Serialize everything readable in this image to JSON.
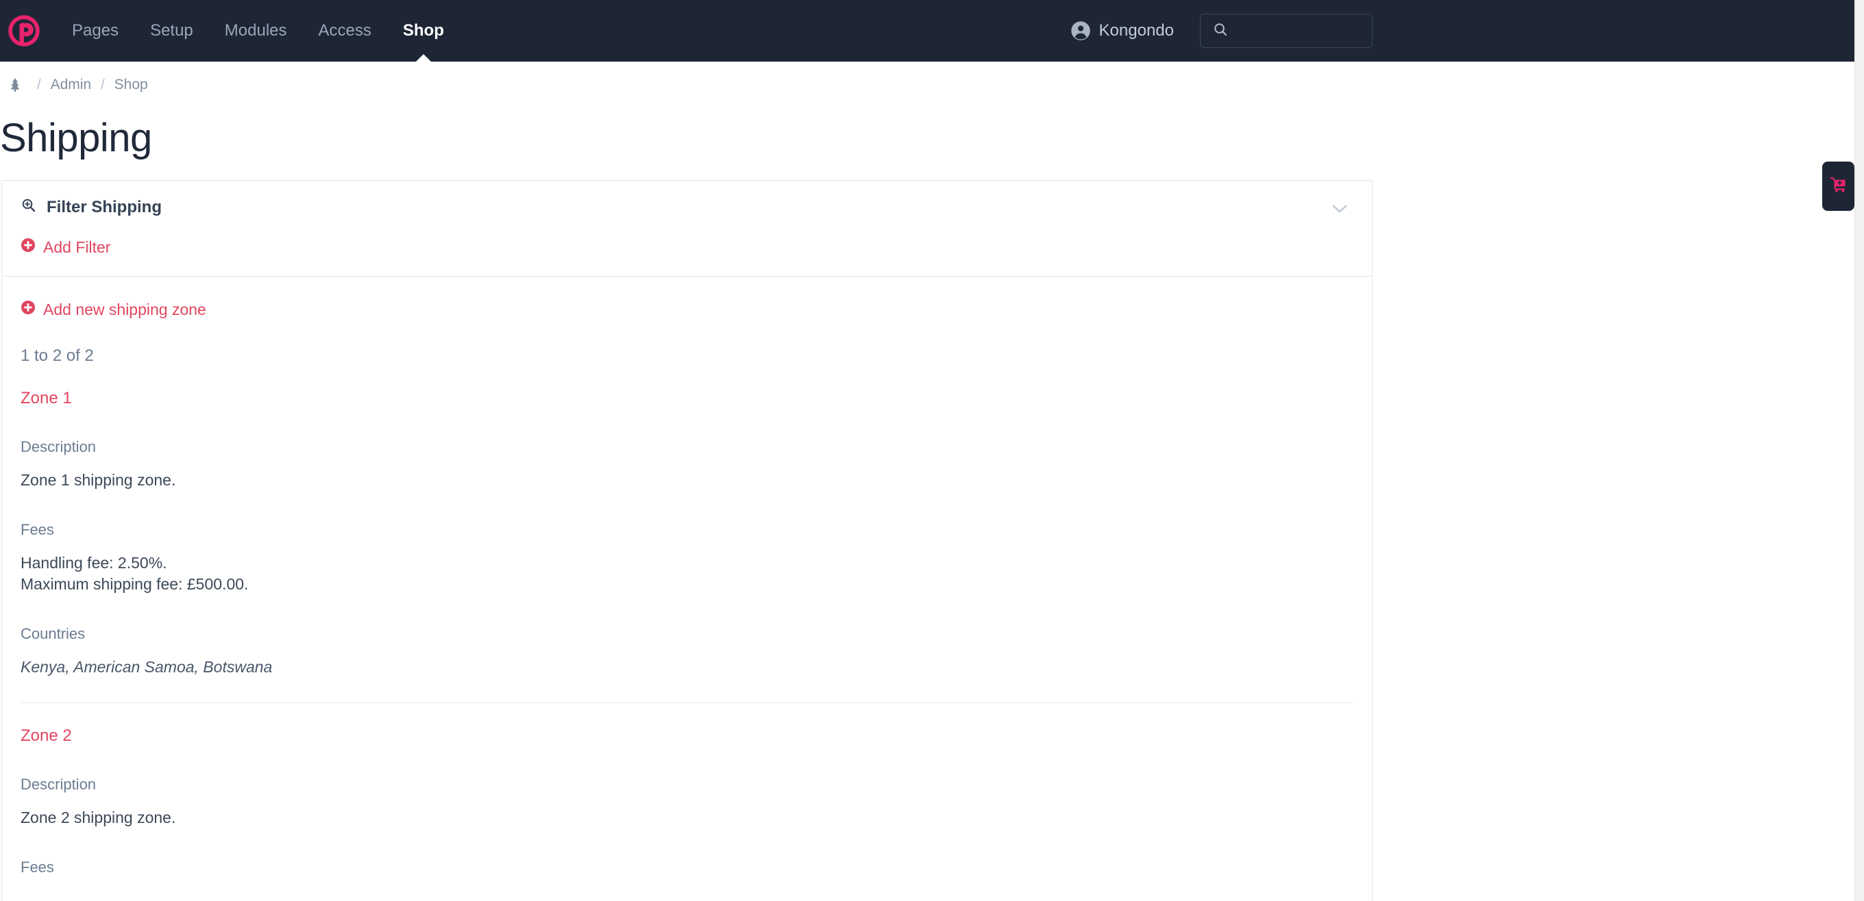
{
  "masthead": {
    "logo_icon": "processwire-logo-icon",
    "brand_color": "#e8236b",
    "bg_color": "#1e2636",
    "nav": [
      {
        "label": "Pages",
        "active": false
      },
      {
        "label": "Setup",
        "active": false
      },
      {
        "label": "Modules",
        "active": false
      },
      {
        "label": "Access",
        "active": false
      },
      {
        "label": "Shop",
        "active": true
      }
    ],
    "user": {
      "name": "Kongondo",
      "avatar_icon": "user-circle-icon"
    },
    "search": {
      "icon": "search-icon",
      "value": "",
      "placeholder": ""
    }
  },
  "breadcrumb": {
    "home_icon": "tree-icon",
    "separator": "/",
    "items": [
      {
        "label": "Admin"
      },
      {
        "label": "Shop"
      }
    ]
  },
  "page": {
    "title": "Shipping"
  },
  "filter_panel": {
    "icon": "search-plus-icon",
    "title": "Filter Shipping",
    "collapse_icon": "chevron-down-icon",
    "add_filter": {
      "icon": "plus-circle-icon",
      "label": "Add Filter"
    }
  },
  "zones_panel": {
    "add_zone": {
      "icon": "plus-circle-icon",
      "label": "Add new shipping zone"
    },
    "result_count": "1 to 2 of 2",
    "labels": {
      "description": "Description",
      "fees": "Fees",
      "countries": "Countries"
    },
    "zones": [
      {
        "title": "Zone 1",
        "description": "Zone 1 shipping zone.",
        "fees": "Handling fee: 2.50%.\nMaximum shipping fee: £500.00.",
        "countries": "Kenya, American Samoa, Botswana"
      },
      {
        "title": "Zone 2",
        "description": "Zone 2 shipping zone.",
        "fees": "",
        "countries": ""
      }
    ]
  },
  "cart_tab": {
    "icon": "cart-plus-icon"
  },
  "colors": {
    "accent_pink": "#e0455f",
    "brand_pink": "#e8236b",
    "dark_navy": "#1e2636",
    "muted_blue": "#6b7c91",
    "border": "#e3e7ec"
  }
}
